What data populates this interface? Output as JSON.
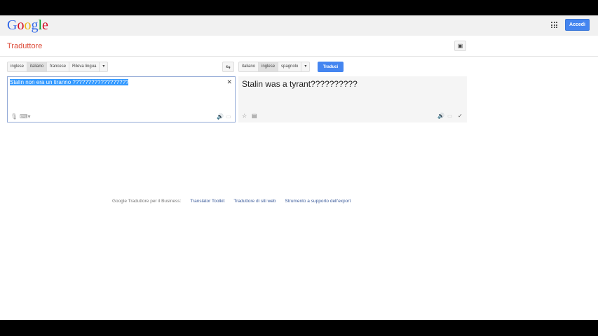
{
  "header": {
    "logo": "Google",
    "signin": "Accedi",
    "apps_icon": "apps-grid-icon"
  },
  "app": {
    "title": "Traduttore",
    "phrasebook_icon": "phrasebook-icon"
  },
  "source": {
    "langs": [
      "inglese",
      "italiano",
      "francese",
      "Rileva lingua"
    ],
    "selected": "italiano",
    "text": "Stalin non era un tiranno ??????????????????"
  },
  "target": {
    "langs": [
      "italiano",
      "inglese",
      "spagnolo"
    ],
    "selected": "inglese",
    "text": "Stalin was a tyrant??????????"
  },
  "translate_button": "Traduci",
  "footer": {
    "label": "Google Traduttore per il Business:",
    "links": [
      "Translator Toolkit",
      "Traduttore di siti web",
      "Strumento a supporto dell'export"
    ]
  }
}
